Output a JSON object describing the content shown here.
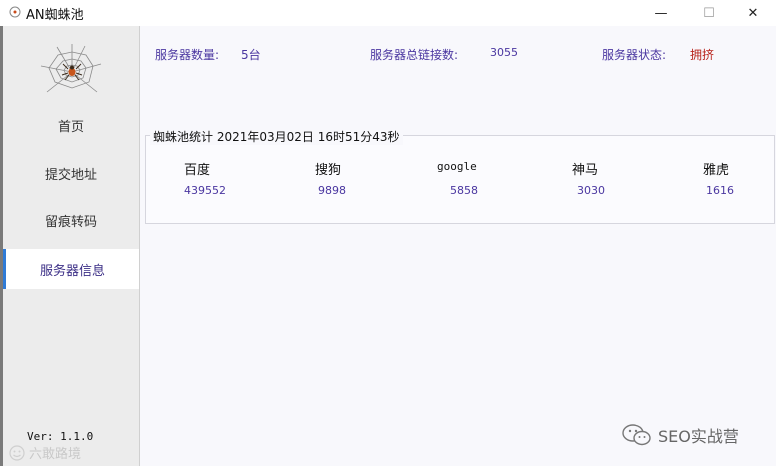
{
  "window": {
    "title": "AN蜘蛛池",
    "min_glyph": "—",
    "max_glyph": "☐",
    "close_glyph": "✕"
  },
  "sidebar": {
    "items": [
      {
        "label": "首页"
      },
      {
        "label": "提交地址"
      },
      {
        "label": "留痕转码"
      },
      {
        "label": "服务器信息",
        "active": true
      }
    ],
    "version": "Ver: 1.1.0",
    "watermark": "六敢路境"
  },
  "stats": {
    "server_count_label": "服务器数量:",
    "server_count_value": "5台",
    "total_links_label": "服务器总链接数:",
    "total_links_value": "3055",
    "status_label": "服务器状态:",
    "status_value": "拥挤",
    "status_color": "#b8241c"
  },
  "spider_stats": {
    "title": "蜘蛛池统计 2021年03月02日 16时51分43秒",
    "engines": [
      {
        "name": "百度",
        "count": "439552"
      },
      {
        "name": "搜狗",
        "count": "9898"
      },
      {
        "name": "google",
        "count": "5858"
      },
      {
        "name": "神马",
        "count": "3030"
      },
      {
        "name": "雅虎",
        "count": "1616"
      }
    ]
  },
  "watermark_right": "SEO实战营",
  "colors": {
    "accent": "#4a36a0",
    "active_border": "#2f7bd6",
    "sidebar_bg": "#ececec"
  }
}
